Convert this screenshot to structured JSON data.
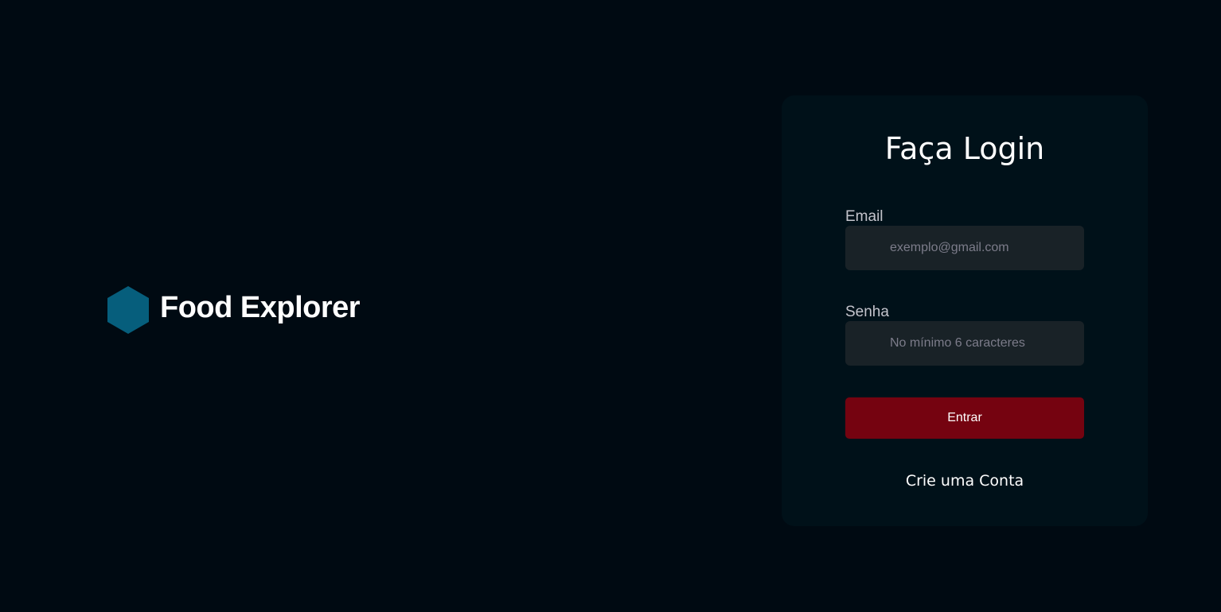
{
  "brand": {
    "name": "Food Explorer",
    "icon": "hexagon-logo-icon",
    "icon_color": "#065e7c"
  },
  "login": {
    "title": "Faça Login",
    "email": {
      "label": "Email",
      "placeholder": "exemplo@gmail.com",
      "value": ""
    },
    "password": {
      "label": "Senha",
      "placeholder": "No mínimo 6 caracteres",
      "value": ""
    },
    "submit_label": "Entrar",
    "signup_label": "Crie uma Conta"
  },
  "colors": {
    "background": "#000a12",
    "card": "#001119",
    "input": "#192227",
    "accent": "#750310",
    "text": "#ffffff",
    "label": "#c4c4cc",
    "placeholder": "#7c7c8a"
  }
}
